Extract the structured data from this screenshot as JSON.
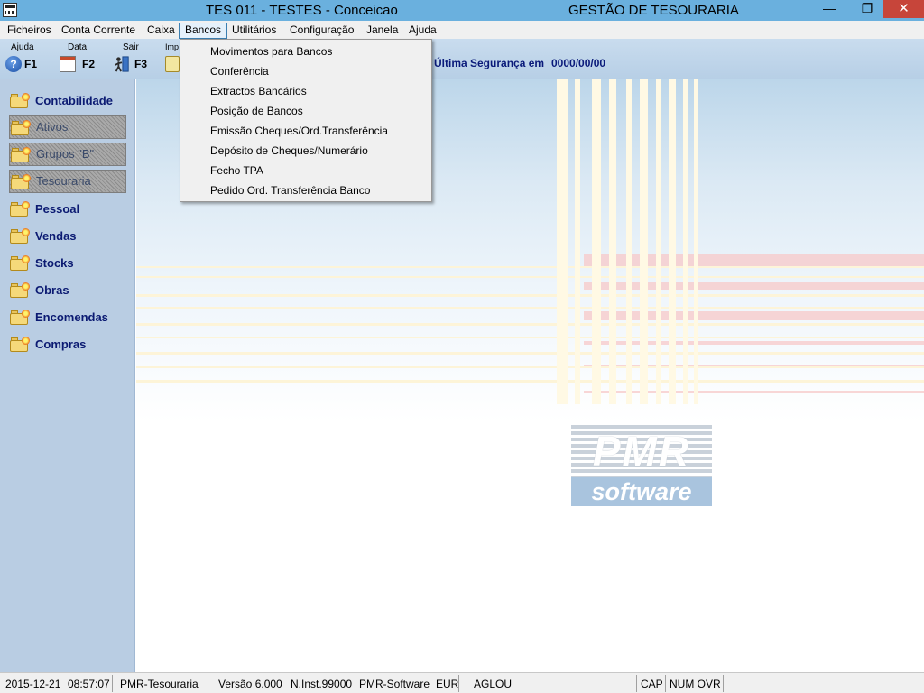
{
  "window": {
    "title": "TES 011 - TESTES - Conceicao",
    "subtitle": "GESTÃO DE TESOURARIA",
    "minimize_glyph": "—",
    "restore_glyph": "❐",
    "close_glyph": "✕"
  },
  "menubar": [
    "Ficheiros",
    "Conta Corrente",
    "Caixa",
    "Bancos",
    "Utilitários",
    "Configuração",
    "Janela",
    "Ajuda"
  ],
  "menubar_active": "Bancos",
  "toolbar": {
    "buttons": [
      {
        "caption": "Ajuda",
        "key": "F1",
        "icon": "help-icon"
      },
      {
        "caption": "Data",
        "key": "F2",
        "icon": "calendar-icon"
      },
      {
        "caption": "Sair",
        "key": "F3",
        "icon": "exit-icon"
      },
      {
        "caption": "Imp",
        "key": "",
        "icon": "print-icon"
      }
    ],
    "backup_label": "Última Segurança em",
    "backup_date": "0000/00/00"
  },
  "bancos_menu": [
    "Movimentos para Bancos",
    "Conferência",
    "Extractos Bancários",
    "Posição de Bancos",
    "Emissão Cheques/Ord.Transferência",
    "Depósito de Cheques/Numerário",
    "Fecho TPA",
    "Pedido Ord. Transferência Banco"
  ],
  "sidebar": [
    {
      "label": "Contabilidade",
      "sub": false
    },
    {
      "label": "Ativos",
      "sub": true
    },
    {
      "label": "Grupos \"B\"",
      "sub": true
    },
    {
      "label": "Tesouraria",
      "sub": true
    },
    {
      "label": "Pessoal",
      "sub": false
    },
    {
      "label": "Vendas",
      "sub": false
    },
    {
      "label": "Stocks",
      "sub": false
    },
    {
      "label": "Obras",
      "sub": false
    },
    {
      "label": "Encomendas",
      "sub": false
    },
    {
      "label": "Compras",
      "sub": false
    }
  ],
  "logo": {
    "top": "PMR",
    "bottom": "software"
  },
  "statusbar": {
    "date": "2015-12-21",
    "time": "08:57:07",
    "app": "PMR-Tesouraria",
    "version": "Versão  6.000",
    "install": "N.Inst.99000",
    "vendor": "PMR-Software",
    "currency": "EUR",
    "user": "AGLOU",
    "cap": "CAP",
    "num_ovr": "NUM OVR"
  },
  "colors": {
    "titlebar": "#6ab0de",
    "sidebar": "#b9cde3",
    "sidebar_text": "#0b1a72",
    "close_button": "#c7453a",
    "menu_highlight_border": "#3c7fb1"
  }
}
